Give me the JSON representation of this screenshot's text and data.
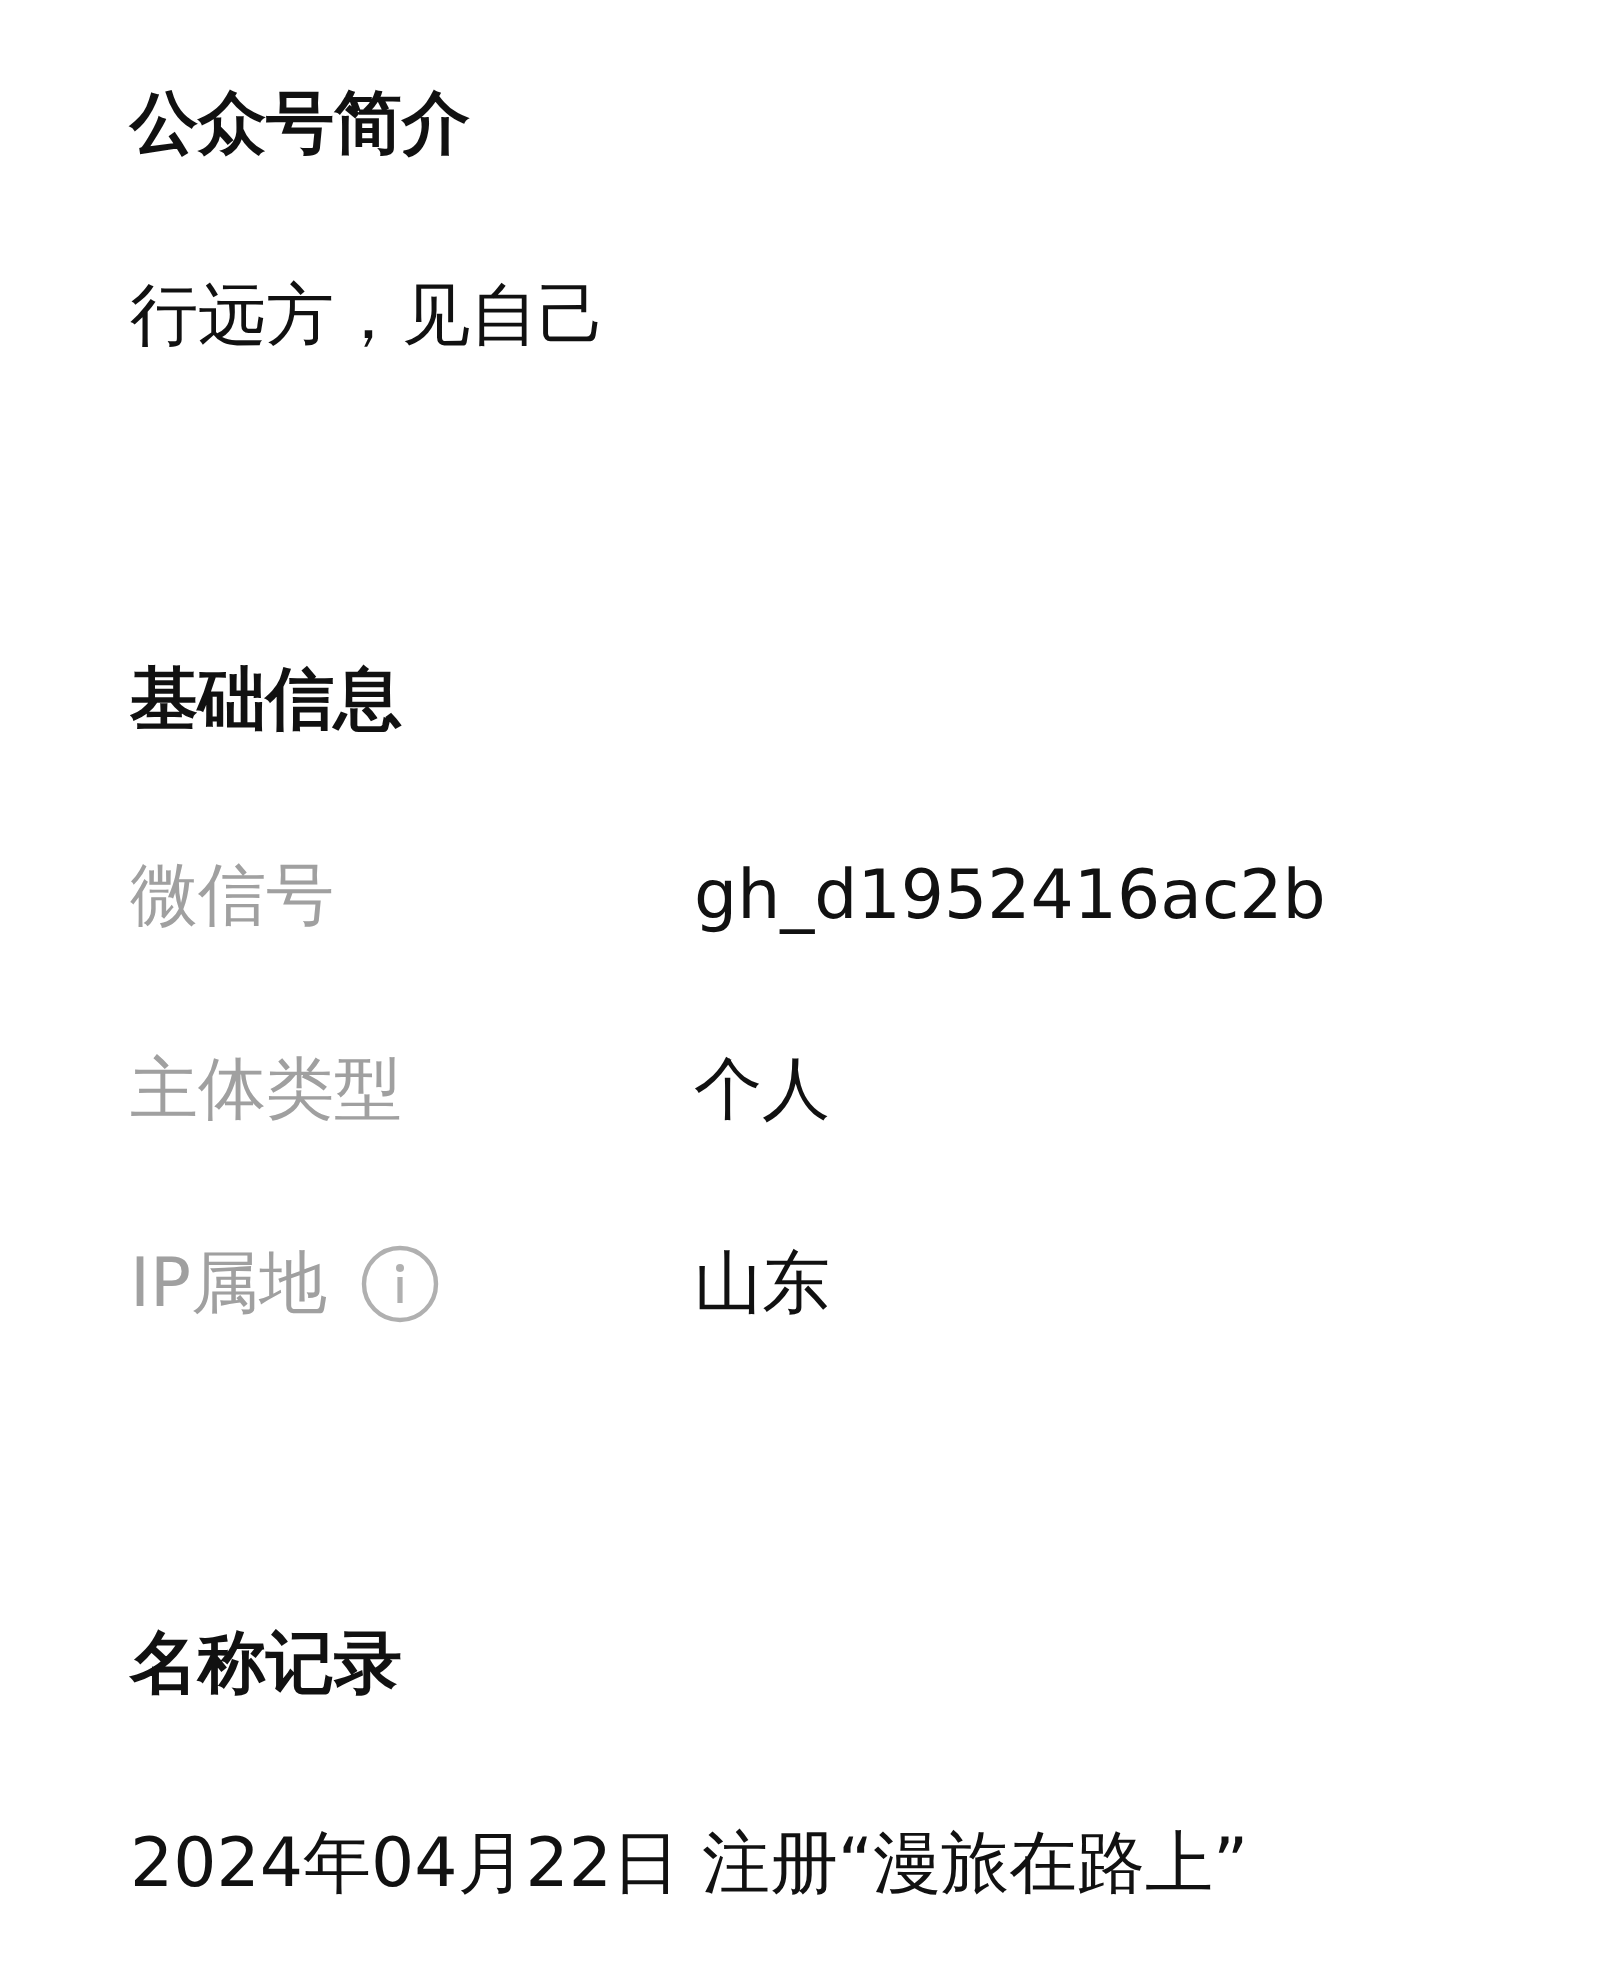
{
  "intro": {
    "title": "公众号简介",
    "text": "行远方，见自己"
  },
  "basic_info": {
    "title": "基础信息",
    "rows": [
      {
        "label": "微信号",
        "value": "gh_d1952416ac2b",
        "has_info": false
      },
      {
        "label": "主体类型",
        "value": "个人",
        "has_info": false
      },
      {
        "label": "IP属地",
        "value": "山东",
        "has_info": true
      }
    ]
  },
  "name_history": {
    "title": "名称记录",
    "records": [
      "2024年04月22日 注册“漫旅在路上”"
    ]
  }
}
